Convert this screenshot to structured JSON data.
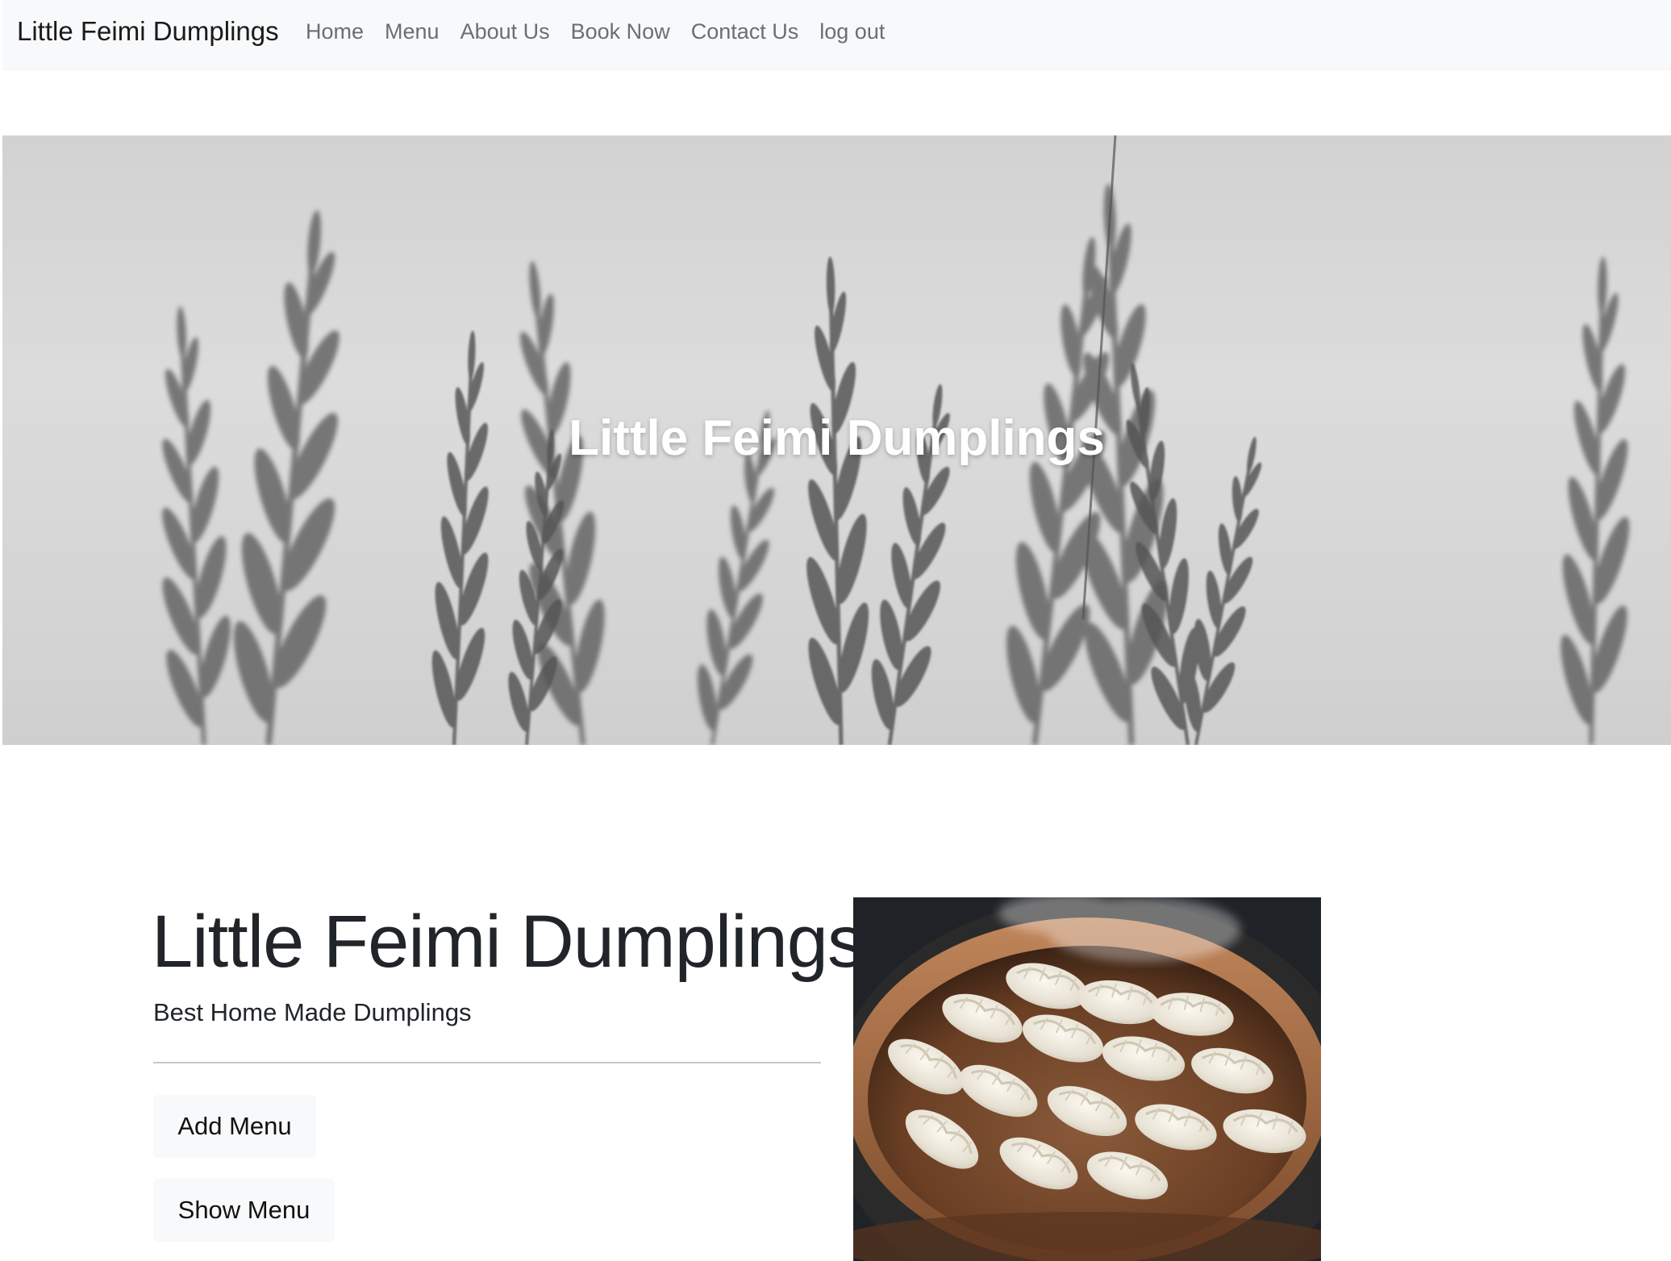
{
  "navbar": {
    "brand": "Little Feimi Dumplings",
    "links": [
      {
        "label": "Home"
      },
      {
        "label": "Menu"
      },
      {
        "label": "About Us"
      },
      {
        "label": "Book Now"
      },
      {
        "label": "Contact Us"
      },
      {
        "label": "log out"
      }
    ]
  },
  "hero": {
    "title": "Little Feimi Dumplings",
    "image": "grass-background-image"
  },
  "main": {
    "title": "Little Feimi Dumplings",
    "subtitle": "Best Home Made Dumplings",
    "add_menu_label": "Add Menu",
    "show_menu_label": "Show Menu",
    "image": "dumplings-steamer-image"
  },
  "colors": {
    "navbar_bg": "#f8f9fa",
    "nav_link": "#6b6e72",
    "text_dark": "#212529",
    "button_bg": "#f8f9fa"
  }
}
